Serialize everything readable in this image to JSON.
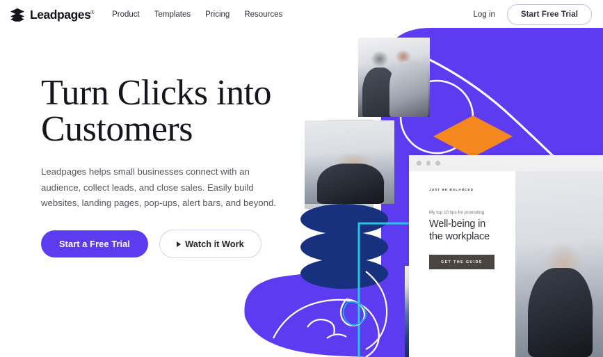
{
  "brand": {
    "name": "Leadpages",
    "trademark": "®",
    "logo_icon": "stacked-layers-icon",
    "accent_purple": "#5D3BF0",
    "deep_blue": "#17317E",
    "orange": "#F5871F",
    "cyan": "#22C8E0",
    "text_dark": "#15161D",
    "text_muted": "#555862"
  },
  "header": {
    "nav": [
      {
        "label": "Product"
      },
      {
        "label": "Templates"
      },
      {
        "label": "Pricing"
      },
      {
        "label": "Resources"
      }
    ],
    "login_label": "Log in",
    "trial_label": "Start Free Trial"
  },
  "hero": {
    "headline_line1": "Turn Clicks into",
    "headline_line2": "Customers",
    "subcopy": "Leadpages helps small businesses connect with an audience, collect leads, and close sales. Easily build websites, landing pages, pop-ups, alert bars, and beyond.",
    "primary_cta": "Start a Free Trial",
    "secondary_cta": "Watch it Work",
    "secondary_cta_icon": "play-triangle-icon"
  },
  "mockup": {
    "window_dots": 3,
    "eyebrow": "JUST BE BALANCED",
    "kicker": "My top 10 tips for promoting",
    "title_line1": "Well-being in",
    "title_line2": "the workplace",
    "button_label": "GET THE GUIDE"
  },
  "artwork": {
    "shapes": [
      {
        "name": "purple-rounded-panel",
        "color": "#5D3BF0"
      },
      {
        "name": "purple-blob-lower",
        "color": "#5D3BF0"
      },
      {
        "name": "dark-blue-stacked-blobs",
        "color": "#17317E"
      },
      {
        "name": "orange-diamond",
        "color": "#F5871F"
      },
      {
        "name": "white-arc-line",
        "color": "#FFFFFF"
      },
      {
        "name": "white-circle-outline",
        "color": "#FFFFFF"
      },
      {
        "name": "cyan-corner-line",
        "color": "#22C8E0"
      },
      {
        "name": "white-doodle-line",
        "color": "#FFFFFF"
      },
      {
        "name": "grey-rounded-shape",
        "color": "#C9CCD2"
      }
    ],
    "photos": [
      {
        "name": "photo-two-men-laptop"
      },
      {
        "name": "photo-smiling-woman"
      },
      {
        "name": "photo-woman-market"
      },
      {
        "name": "photo-dog"
      },
      {
        "name": "photo-circle-badge"
      },
      {
        "name": "photo-woman-stretching"
      }
    ]
  }
}
